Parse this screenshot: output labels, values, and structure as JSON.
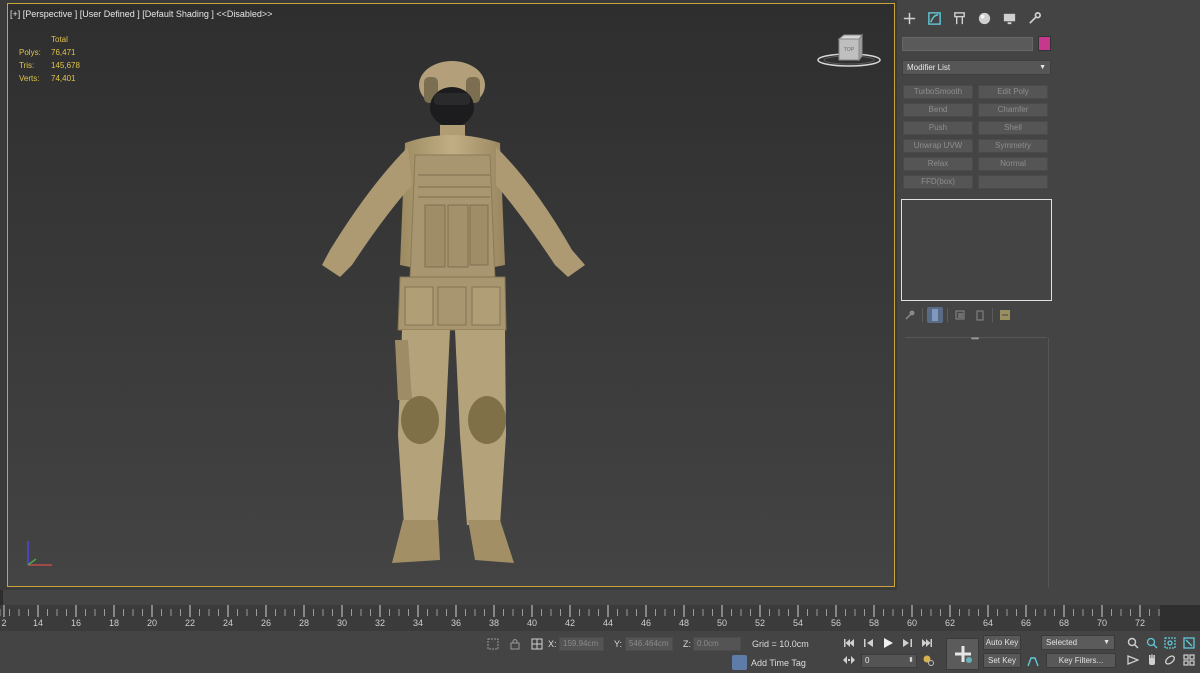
{
  "viewport": {
    "label": "[+] [Perspective ] [User Defined ] [Default Shading ] <<Disabled>>",
    "stats": {
      "header": "Total",
      "rows": [
        {
          "key": "Polys:",
          "value": "76,471"
        },
        {
          "key": "Tris:",
          "value": "145,678"
        },
        {
          "key": "Verts:",
          "value": "74,401"
        }
      ]
    },
    "viewcube_label": "TOP"
  },
  "command_panel": {
    "tabs": [
      {
        "icon": "create-icon"
      },
      {
        "icon": "modify-icon",
        "active": true
      },
      {
        "icon": "hierarchy-icon"
      },
      {
        "icon": "motion-icon"
      },
      {
        "icon": "display-icon"
      },
      {
        "icon": "utilities-icon"
      }
    ],
    "object_color": "#c6388b",
    "modifier_list": "Modifier List",
    "modifier_buttons": [
      "TurboSmooth",
      "Edit Poly",
      "Bend",
      "Chamfer",
      "Push",
      "Shell",
      "Unwrap UVW",
      "Symmetry",
      "Relax",
      "Normal",
      "FFD(box)",
      ""
    ]
  },
  "timeline": {
    "ticks": [
      "2",
      "14",
      "16",
      "18",
      "20",
      "22",
      "24",
      "26",
      "28",
      "30",
      "32",
      "34",
      "36",
      "38",
      "40",
      "42",
      "44",
      "46",
      "48",
      "50",
      "52",
      "54",
      "56",
      "58",
      "60",
      "62",
      "64",
      "66",
      "68",
      "70",
      "72"
    ]
  },
  "status": {
    "x_label": "X:",
    "x_value": "159.94cm",
    "y_label": "Y:",
    "y_value": "546.464cm",
    "z_label": "Z:",
    "z_value": "0.0cm",
    "grid": "Grid = 10.0cm",
    "add_time_tag": "Add Time Tag",
    "frame": "0",
    "auto_key": "Auto Key",
    "set_key": "Set Key",
    "selected": "Selected",
    "key_filters": "Key Filters..."
  },
  "colors": {
    "viewport_border": "#c8a53a",
    "stats_text": "#e0c34b",
    "accent": "#5fc9d8",
    "model": "#b8a57c"
  }
}
